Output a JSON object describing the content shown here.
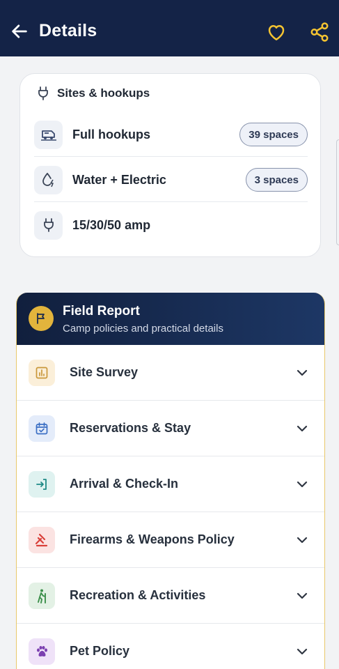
{
  "appbar": {
    "title": "Details",
    "icons": {
      "back": "arrow-left-icon",
      "favorite": "heart-icon",
      "share": "share-icon"
    },
    "colors": {
      "background": "#142347",
      "accent": "#f5c431"
    }
  },
  "sites": {
    "heading": "Sites & hookups",
    "heading_icon": "plug-icon",
    "items": [
      {
        "label": "Full hookups",
        "badge": "39 spaces",
        "icon": "rv-icon"
      },
      {
        "label": "Water + Electric",
        "badge": "3 spaces",
        "icon": "water-electric-icon"
      },
      {
        "label": "15/30/50 amp",
        "badge": "",
        "icon": "plug-icon"
      }
    ]
  },
  "field_report": {
    "title": "Field Report",
    "subtitle": "Camp policies and practical details",
    "icon": "flag-icon",
    "sections": [
      {
        "label": "Site Survey",
        "icon": "chart-icon",
        "color": "#c9983a"
      },
      {
        "label": "Reservations & Stay",
        "icon": "calendar-check-icon",
        "color": "#3b6fc4"
      },
      {
        "label": "Arrival & Check-In",
        "icon": "login-icon",
        "color": "#1f8a86"
      },
      {
        "label": "Firearms & Weapons Policy",
        "icon": "gavel-icon",
        "color": "#d9403a"
      },
      {
        "label": "Recreation & Activities",
        "icon": "hiking-icon",
        "color": "#3b8f4a"
      },
      {
        "label": "Pet Policy",
        "icon": "paw-icon",
        "color": "#7b3fb0"
      }
    ]
  }
}
